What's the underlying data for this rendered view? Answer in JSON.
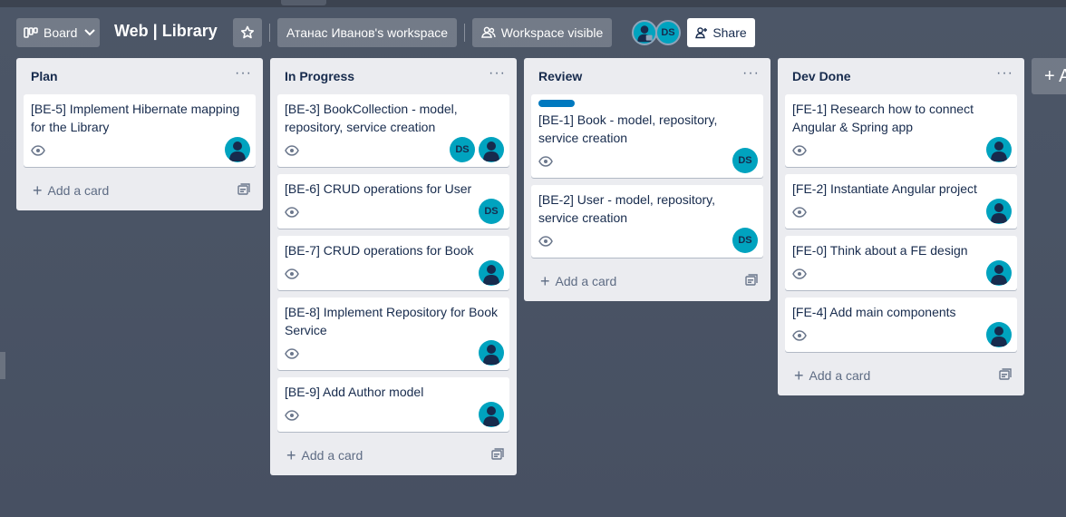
{
  "header": {
    "view_label": "Board",
    "board_title": "Web | Library",
    "workspace_label": "Атанас Иванов's workspace",
    "visibility_label": "Workspace visible",
    "member_initials": "DS",
    "share_label": "Share"
  },
  "lists": [
    {
      "title": "Plan",
      "menu": "···",
      "add_card": "Add a card",
      "cards": [
        {
          "title": "[BE-5] Implement Hibernate mapping for the Library",
          "members": [
            "user"
          ]
        }
      ]
    },
    {
      "title": "In Progress",
      "menu": "···",
      "add_card": "Add a card",
      "cards": [
        {
          "title": "[BE-3] BookCollection - model, repository, service creation",
          "members": [
            "DS",
            "user"
          ]
        },
        {
          "title": "[BE-6] CRUD operations for User",
          "members": [
            "DS"
          ]
        },
        {
          "title": "[BE-7] CRUD operations for Book",
          "members": [
            "user"
          ]
        },
        {
          "title": "[BE-8] Implement Repository for Book Service",
          "members": [
            "user"
          ]
        },
        {
          "title": "[BE-9] Add Author model",
          "members": [
            "user"
          ]
        }
      ]
    },
    {
      "title": "Review",
      "menu": "···",
      "add_card": "Add a card",
      "cards": [
        {
          "title": "[BE-1] Book - model, repository, service creation",
          "label_color": "#0079bf",
          "members": [
            "DS"
          ]
        },
        {
          "title": "[BE-2] User - model, repository, service creation",
          "members": [
            "DS"
          ]
        }
      ]
    },
    {
      "title": "Dev Done",
      "menu": "···",
      "add_card": "Add a card",
      "cards": [
        {
          "title": "[FE-1] Research how to connect Angular & Spring app",
          "members": [
            "user"
          ]
        },
        {
          "title": "[FE-2] Instantiate Angular project",
          "members": [
            "user"
          ]
        },
        {
          "title": "[FE-0] Think about a FE design",
          "members": [
            "user"
          ]
        },
        {
          "title": "[FE-4] Add main components",
          "members": [
            "user"
          ]
        }
      ]
    }
  ],
  "add_list_label": "+ A",
  "colors": {
    "avatar": "#00a3bf",
    "label_blue": "#0079bf",
    "list_bg": "#ebecf0"
  }
}
